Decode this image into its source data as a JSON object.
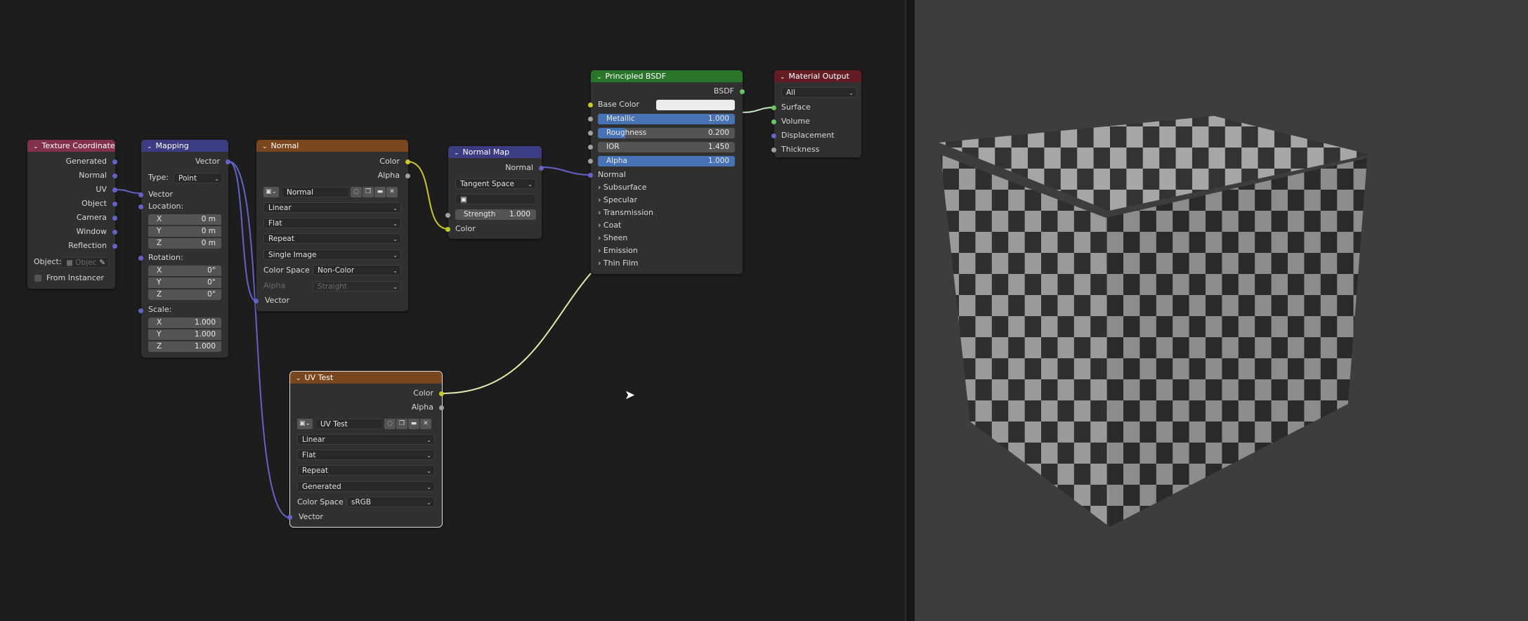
{
  "texcoord": {
    "title": "Texture Coordinate",
    "outputs": [
      "Generated",
      "Normal",
      "UV",
      "Object",
      "Camera",
      "Window",
      "Reflection"
    ],
    "object_label": "Object:",
    "object_placeholder": "Objec",
    "from_instancer": "From Instancer"
  },
  "mapping": {
    "title": "Mapping",
    "output": "Vector",
    "type_label": "Type:",
    "type_value": "Point",
    "vector_input": "Vector",
    "location_label": "Location:",
    "location": [
      {
        "axis": "X",
        "value": "0 m"
      },
      {
        "axis": "Y",
        "value": "0 m"
      },
      {
        "axis": "Z",
        "value": "0 m"
      }
    ],
    "rotation_label": "Rotation:",
    "rotation": [
      {
        "axis": "X",
        "value": "0°"
      },
      {
        "axis": "Y",
        "value": "0°"
      },
      {
        "axis": "Z",
        "value": "0°"
      }
    ],
    "scale_label": "Scale:",
    "scale": [
      {
        "axis": "X",
        "value": "1.000"
      },
      {
        "axis": "Y",
        "value": "1.000"
      },
      {
        "axis": "Z",
        "value": "1.000"
      }
    ]
  },
  "normal_tex": {
    "title": "Normal",
    "out_color": "Color",
    "out_alpha": "Alpha",
    "image_name": "Normal",
    "interpolation": "Linear",
    "projection": "Flat",
    "extension": "Repeat",
    "source": "Single Image",
    "colorspace_label": "Color Space",
    "colorspace": "Non-Color",
    "alpha_label": "Alpha",
    "alpha_mode": "Straight",
    "vector_input": "Vector"
  },
  "normal_map": {
    "title": "Normal Map",
    "output": "Normal",
    "space": "Tangent Space",
    "strength_label": "Strength",
    "strength": "1.000",
    "color_input": "Color"
  },
  "bsdf": {
    "title": "Principled BSDF",
    "output": "BSDF",
    "base_color_label": "Base Color",
    "metallic_label": "Metallic",
    "metallic": "1.000",
    "roughness_label": "Roughness",
    "roughness": "0.200",
    "ior_label": "IOR",
    "ior": "1.450",
    "alpha_label": "Alpha",
    "alpha": "1.000",
    "normal_label": "Normal",
    "panels": [
      "Subsurface",
      "Specular",
      "Transmission",
      "Coat",
      "Sheen",
      "Emission",
      "Thin Film"
    ]
  },
  "output": {
    "title": "Material Output",
    "target": "All",
    "inputs": [
      "Surface",
      "Volume",
      "Displacement",
      "Thickness"
    ]
  },
  "uvtest": {
    "title": "UV Test",
    "out_color": "Color",
    "out_alpha": "Alpha",
    "image_name": "UV Test",
    "interpolation": "Linear",
    "projection": "Flat",
    "extension": "Repeat",
    "source": "Generated",
    "colorspace_label": "Color Space",
    "colorspace": "sRGB",
    "vector_input": "Vector"
  },
  "colors": {
    "input_header": "#83314a",
    "vector_header": "#3c3c83",
    "texture_header": "#79461d",
    "shader_header": "#28752b",
    "output_header": "#631c23",
    "active_field": "#4772b3",
    "socket_vector": "#6363c7",
    "socket_color": "#c7c729",
    "socket_float": "#a1a1a1",
    "socket_shader": "#63c763"
  }
}
